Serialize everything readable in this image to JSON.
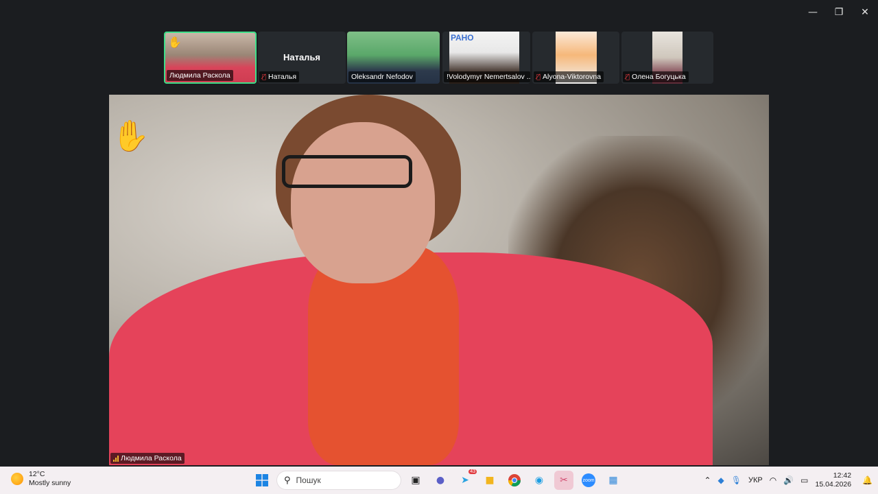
{
  "window": {
    "minimize": "—",
    "restore": "❐",
    "close": "✕"
  },
  "participants": [
    {
      "name": "Людмила Раскола",
      "hand_raised": true,
      "active": true
    },
    {
      "name": "Наталья",
      "display_title": "Наталья",
      "muted": true
    },
    {
      "name": "Oleksandr Nefodov"
    },
    {
      "name": "!Volodymyr Nemertsalov ...",
      "partial_text": "РАНО"
    },
    {
      "name": "Alyona-Viktorovna",
      "muted": true
    },
    {
      "name": "Олена Богуцька",
      "muted": true
    }
  ],
  "main_video": {
    "speaker": "Людмила Раскола",
    "hand_raised": true
  },
  "taskbar": {
    "weather_temp": "12°C",
    "weather_desc": "Mostly sunny",
    "search_placeholder": "Пошук",
    "telegram_badge": "43",
    "zoom_label": "zoom",
    "language": "УКР",
    "time": "12:42",
    "date": "15.04.2026"
  }
}
